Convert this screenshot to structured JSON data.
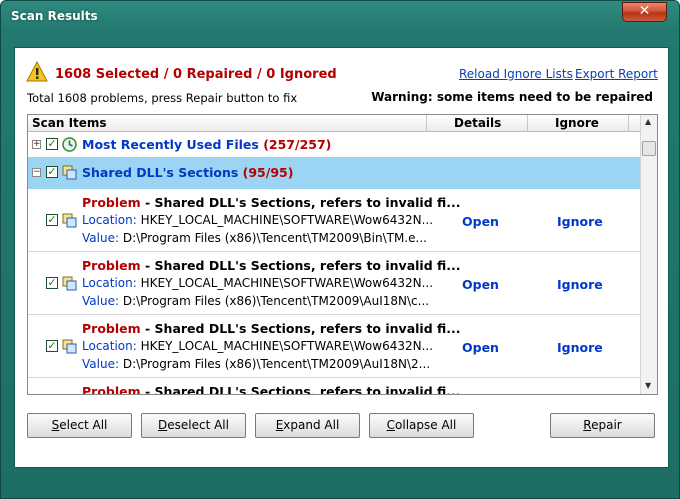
{
  "window": {
    "title": "Scan Results",
    "close_glyph": "✕"
  },
  "header": {
    "summary": "1608 Selected / 0 Repaired / 0 Ignored",
    "subtitle": "Total 1608 problems, press Repair button to fix",
    "warning": "Warning: some items need to be repaired",
    "links": {
      "reload": "Reload Ignore Lists",
      "export": "Export Report"
    },
    "icon": "warning-triangle-icon"
  },
  "grid": {
    "columns": {
      "items": "Scan Items",
      "details": "Details",
      "ignore": "Ignore"
    },
    "groups": [
      {
        "expander": "+",
        "label": "Most Recently Used Files",
        "count": "(257/257)",
        "icon": "recent-files-icon"
      },
      {
        "expander": "−",
        "label": "Shared DLL's Sections",
        "count": "(95/95)",
        "icon": "registry-icon"
      }
    ],
    "items": [
      {
        "problem_prefix": "Problem",
        "problem_text": " - Shared DLL's Sections, refers to invalid fi...",
        "location_key": "Location:",
        "location": "HKEY_LOCAL_MACHINE\\SOFTWARE\\Wow6432N...",
        "value_key": "Value:",
        "value": "D:\\Program Files (x86)\\Tencent\\TM2009\\Bin\\TM.e...",
        "open": "Open",
        "ignore": "Ignore"
      },
      {
        "problem_prefix": "Problem",
        "problem_text": " - Shared DLL's Sections, refers to invalid fi...",
        "location_key": "Location:",
        "location": "HKEY_LOCAL_MACHINE\\SOFTWARE\\Wow6432N...",
        "value_key": "Value:",
        "value": "D:\\Program Files (x86)\\Tencent\\TM2009\\AuI18N\\c...",
        "open": "Open",
        "ignore": "Ignore"
      },
      {
        "problem_prefix": "Problem",
        "problem_text": " - Shared DLL's Sections, refers to invalid fi...",
        "location_key": "Location:",
        "location": "HKEY_LOCAL_MACHINE\\SOFTWARE\\Wow6432N...",
        "value_key": "Value:",
        "value": "D:\\Program Files (x86)\\Tencent\\TM2009\\AuI18N\\2...",
        "open": "Open",
        "ignore": "Ignore"
      },
      {
        "problem_prefix": "Problem",
        "problem_text": " - Shared DLL's Sections, refers to invalid fi...",
        "open": "",
        "ignore": ""
      }
    ]
  },
  "buttons": {
    "select_all_u": "S",
    "select_all": "elect All",
    "deselect_all_u": "D",
    "deselect_all": "eselect All",
    "expand_all_u": "E",
    "expand_all": "xpand All",
    "collapse_all_u": "C",
    "collapse_all": "ollapse All",
    "repair_u": "R",
    "repair": "epair"
  },
  "colors": {
    "titlebar": "#23796f",
    "accent_red": "#b40000",
    "link_blue": "#0038c8",
    "selected_row": "#9cd4f3"
  }
}
